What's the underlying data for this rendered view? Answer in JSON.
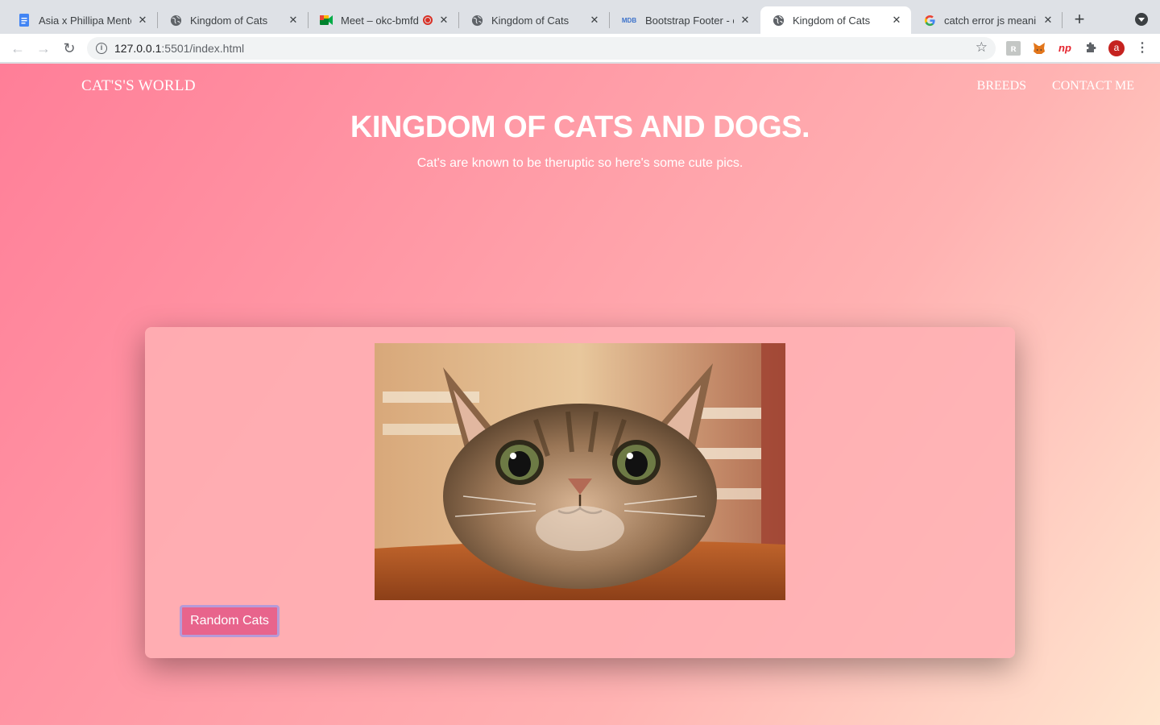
{
  "browser": {
    "tabs": [
      {
        "title": "Asia x Phillipa Mentor",
        "icon": "google-docs-icon"
      },
      {
        "title": "Kingdom of Cats",
        "icon": "globe-icon"
      },
      {
        "title": "Meet – okc-bmfd",
        "icon": "google-meet-icon"
      },
      {
        "title": "Kingdom of Cats",
        "icon": "globe-icon"
      },
      {
        "title": "Bootstrap Footer - ex",
        "icon": "mdb-icon"
      },
      {
        "title": "Kingdom of Cats",
        "icon": "globe-icon"
      },
      {
        "title": "catch error js meaning",
        "icon": "google-icon"
      }
    ],
    "active_tab": 5,
    "url_host": "127.0.0.1",
    "url_rest": ":5501/index.html",
    "profile_initial": "a"
  },
  "site": {
    "brand": "CAT'S'S WORLD",
    "nav": {
      "breeds": "BREEDS",
      "contact": "CONTACT ME"
    },
    "title": "KINGDOM OF CATS AND DOGS.",
    "subtitle": "Cat's are known to be theruptic so here's some cute pics.",
    "button_label": "Random Cats"
  },
  "colors": {
    "gradient_start": "#ff7e98",
    "gradient_end": "#ffe6cf",
    "button": "#e8648c",
    "button_border": "#b69bd8"
  }
}
